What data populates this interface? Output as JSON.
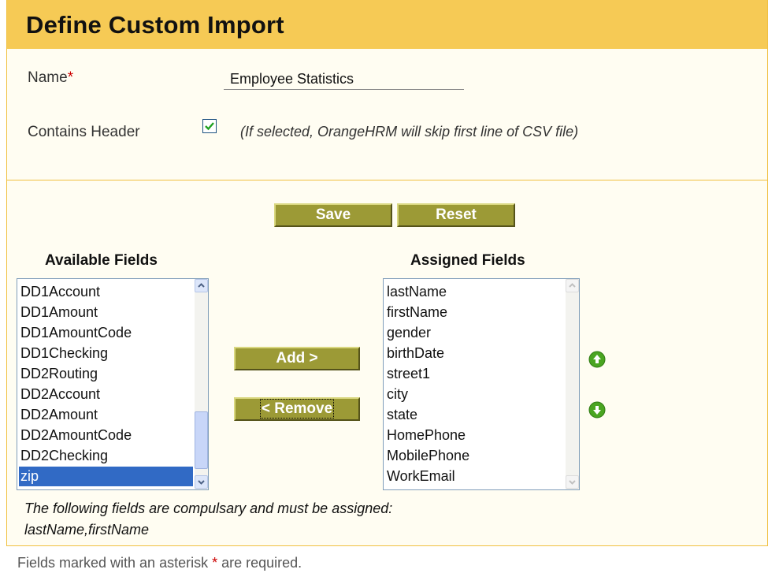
{
  "header": {
    "title": "Define Custom Import"
  },
  "form": {
    "name_label": "Name",
    "required_mark": "*",
    "name_value": "Employee Statistics",
    "contains_header_label": "Contains Header",
    "contains_header_checked": true,
    "contains_header_hint": "(If selected, OrangeHRM will skip first line of CSV file)"
  },
  "actions": {
    "save_label": "Save",
    "reset_label": "Reset"
  },
  "available": {
    "heading": "Available Fields",
    "items": [
      "DD1Account",
      "DD1Amount",
      "DD1AmountCode",
      "DD1Checking",
      "DD2Routing",
      "DD2Account",
      "DD2Amount",
      "DD2AmountCode",
      "DD2Checking",
      "zip"
    ],
    "selected": "zip"
  },
  "transfer": {
    "add_label": "Add >",
    "remove_label": "< Remove"
  },
  "assigned": {
    "heading": "Assigned Fields",
    "items": [
      "lastName",
      "firstName",
      "gender",
      "birthDate",
      "street1",
      "city",
      "state",
      "HomePhone",
      "MobilePhone",
      "WorkEmail"
    ]
  },
  "order": {
    "up_icon": "arrow-up-icon",
    "down_icon": "arrow-down-icon",
    "color": "#4aa521"
  },
  "notes": {
    "compulsory_line1": "The following fields are compulsary and must be assigned:",
    "compulsory_line2": "lastName,firstName"
  },
  "footer": {
    "before": "Fields marked with an asterisk",
    "mark": "*",
    "after": " are required."
  }
}
